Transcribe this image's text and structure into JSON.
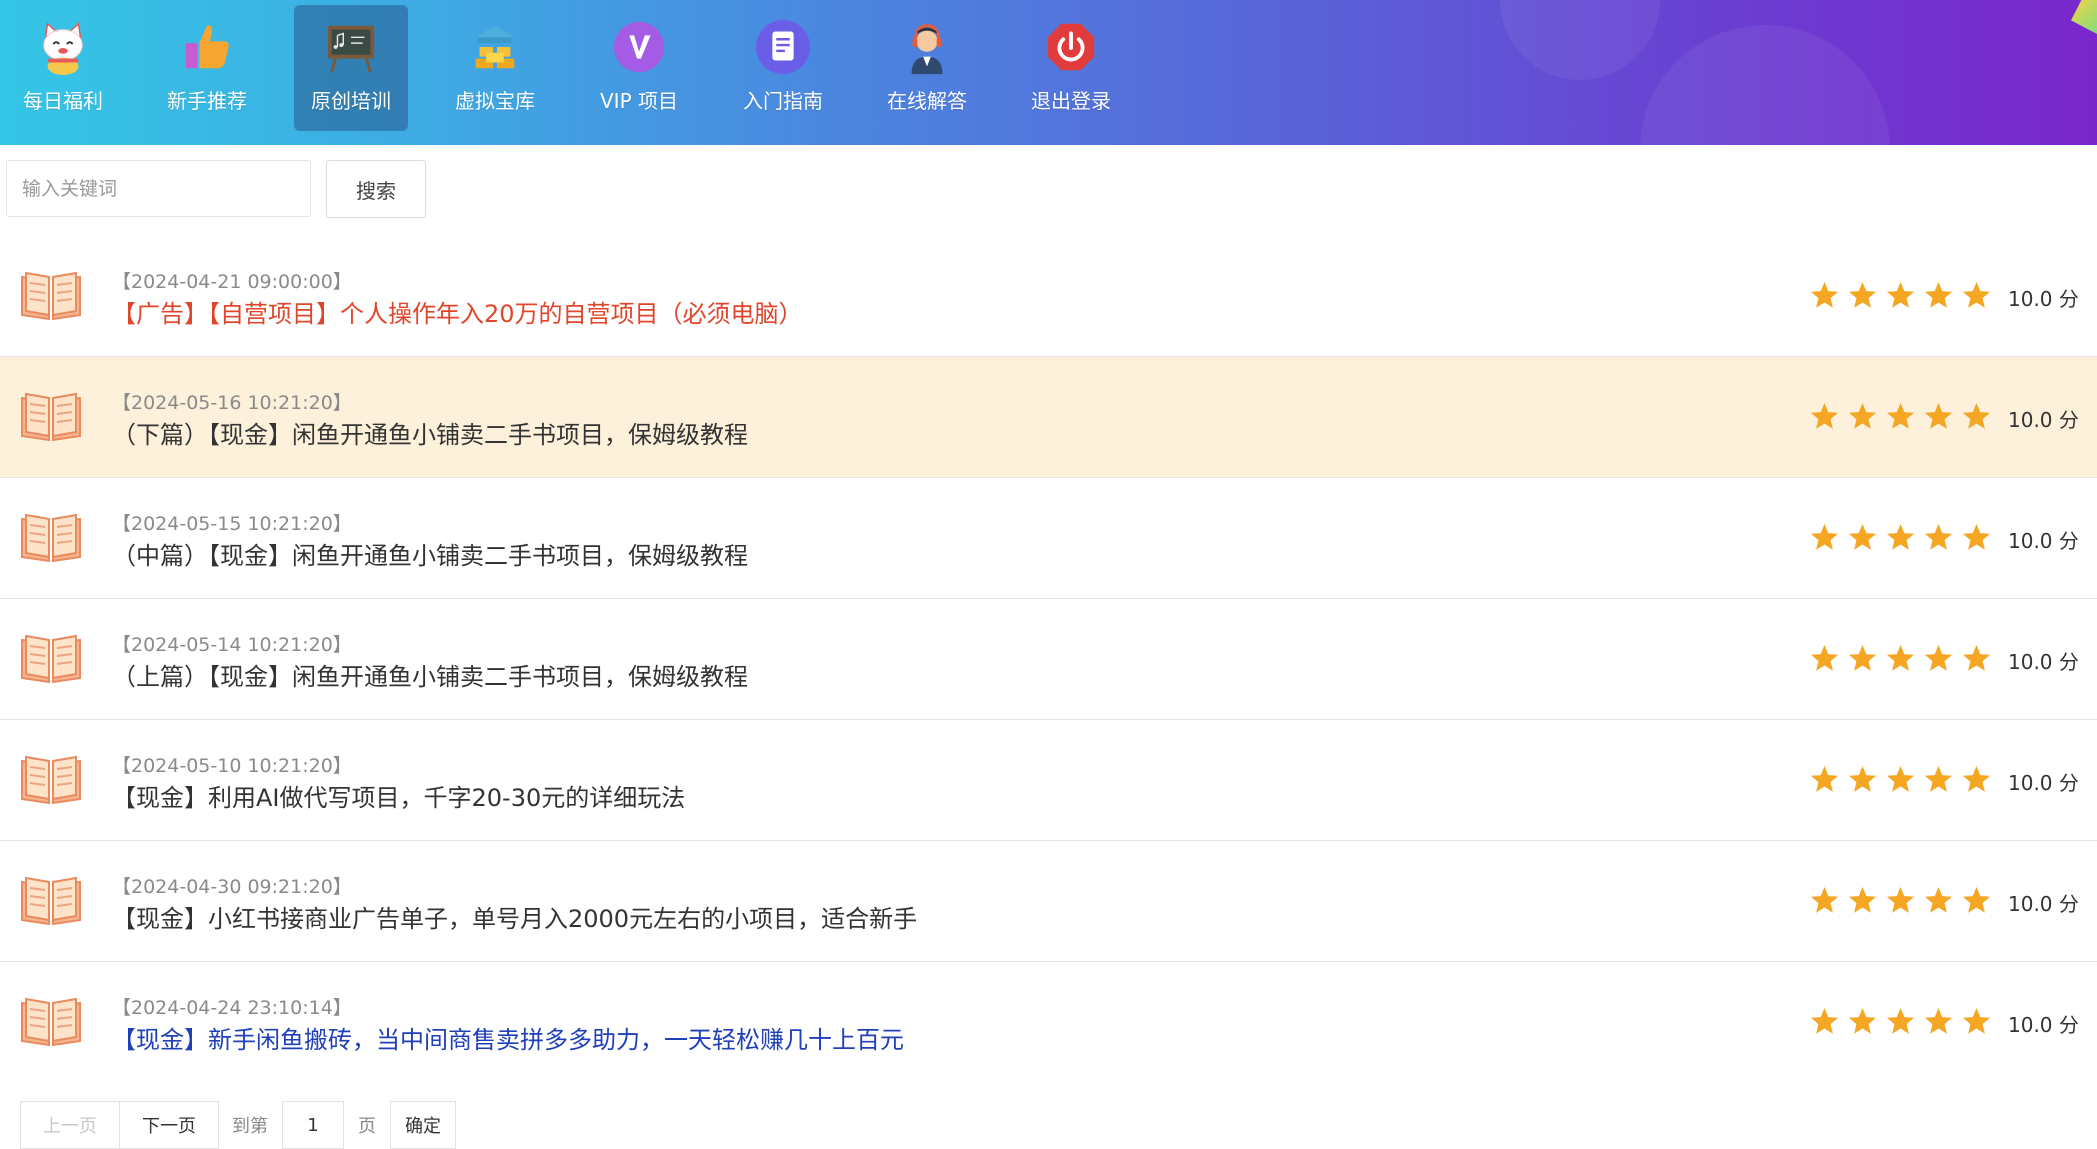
{
  "nav": {
    "items": [
      {
        "label": "每日福利",
        "icon": "lucky-cat-icon"
      },
      {
        "label": "新手推荐",
        "icon": "thumbs-up-icon"
      },
      {
        "label": "原创培训",
        "icon": "blackboard-icon",
        "active": true
      },
      {
        "label": "虚拟宝库",
        "icon": "treasure-building-icon"
      },
      {
        "label": "VIP 项目",
        "icon": "vip-icon"
      },
      {
        "label": "入门指南",
        "icon": "document-icon"
      },
      {
        "label": "在线解答",
        "icon": "support-agent-icon"
      },
      {
        "label": "退出登录",
        "icon": "power-icon"
      }
    ]
  },
  "search": {
    "placeholder": "输入关键词",
    "button_label": "搜索"
  },
  "articles": [
    {
      "date": "【2024-04-21 09:00:00】",
      "title": "【广告】【自营项目】个人操作年入20万的自营项目（必须电脑）",
      "title_color": "#e0462b",
      "rating": 5,
      "score": "10.0 分"
    },
    {
      "date": "【2024-05-16 10:21:20】",
      "title": "（下篇）【现金】闲鱼开通鱼小铺卖二手书项目，保姆级教程",
      "title_color": "#333333",
      "rating": 5,
      "score": "10.0 分",
      "highlighted": true
    },
    {
      "date": "【2024-05-15 10:21:20】",
      "title": "（中篇）【现金】闲鱼开通鱼小铺卖二手书项目，保姆级教程",
      "title_color": "#333333",
      "rating": 5,
      "score": "10.0 分"
    },
    {
      "date": "【2024-05-14 10:21:20】",
      "title": "（上篇）【现金】闲鱼开通鱼小铺卖二手书项目，保姆级教程",
      "title_color": "#333333",
      "rating": 5,
      "score": "10.0 分"
    },
    {
      "date": "【2024-05-10 10:21:20】",
      "title": "【现金】利用AI做代写项目，千字20-30元的详细玩法",
      "title_color": "#333333",
      "rating": 5,
      "score": "10.0 分"
    },
    {
      "date": "【2024-04-30 09:21:20】",
      "title": "【现金】小红书接商业广告单子，单号月入2000元左右的小项目，适合新手",
      "title_color": "#333333",
      "rating": 5,
      "score": "10.0 分"
    },
    {
      "date": "【2024-04-24 23:10:14】",
      "title": "【现金】新手闲鱼搬砖，当中间商售卖拼多多助力，一天轻松赚几十上百元",
      "title_color": "#2040b8",
      "rating": 5,
      "score": "10.0 分"
    }
  ],
  "pagination": {
    "prev_label": "上一页",
    "next_label": "下一页",
    "goto_label": "到第",
    "page_value": "1",
    "page_unit": "页",
    "confirm_label": "确定"
  },
  "colors": {
    "star": "#f5a623",
    "book": "#f4a27a",
    "accent_active": "#2a5e86"
  }
}
